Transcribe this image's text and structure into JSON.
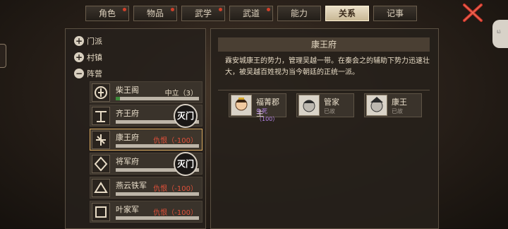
{
  "tabs": [
    {
      "label": "角色",
      "badge": true
    },
    {
      "label": "物品",
      "badge": true
    },
    {
      "label": "武学",
      "badge": true
    },
    {
      "label": "武道",
      "badge": true
    },
    {
      "label": "能力",
      "badge": false
    },
    {
      "label": "关系",
      "badge": false,
      "active": true
    },
    {
      "label": "记事",
      "badge": false
    }
  ],
  "categories": [
    {
      "label": "门派",
      "toggle": "+"
    },
    {
      "label": "村镇",
      "toggle": "+"
    },
    {
      "label": "阵营",
      "toggle": "−"
    }
  ],
  "factions": [
    {
      "name": "柴王阁",
      "status": "中立（3）",
      "relation": 0.05
    },
    {
      "name": "齐王府",
      "status": "",
      "seal": "灭门"
    },
    {
      "name": "康王府",
      "status": "仇恨（-100）",
      "selected": true
    },
    {
      "name": "将军府",
      "status": "",
      "seal": "灭门"
    },
    {
      "name": "燕云铁军",
      "status": "仇恨（-100）"
    },
    {
      "name": "叶家军",
      "status": "仇恨（-100）"
    }
  ],
  "detail": {
    "title": "康王府",
    "description": "霖安城康王的势力，管理吴越一带。在秦会之的辅助下势力迅速壮大，被吴越百姓视为当今朝廷的正统一派。",
    "members": [
      {
        "name": "福菁郡主",
        "status": "生死（100）",
        "status_color": "#b584e8"
      },
      {
        "name": "管家",
        "status": "已故",
        "status_color": "#9d958a"
      },
      {
        "name": "康王",
        "status": "已故",
        "status_color": "#9d958a"
      }
    ]
  },
  "close_icon": "close-x-icon",
  "colors": {
    "hostile": "#e0503a",
    "tab_active": "#eadfc8",
    "badge": "#d0402a"
  }
}
